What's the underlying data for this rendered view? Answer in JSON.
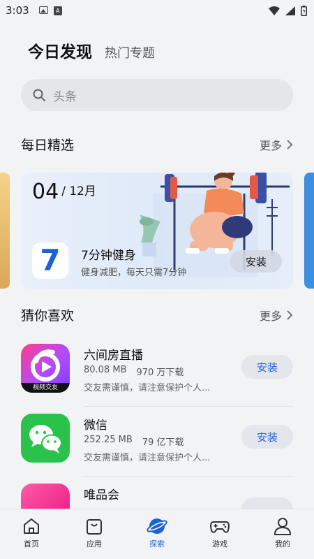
{
  "status_bar": {
    "time": "3:03"
  },
  "top_tabs": {
    "active": "今日发现",
    "other": "热门专题"
  },
  "search": {
    "placeholder": "头条"
  },
  "daily_pick": {
    "title": "每日精选",
    "more": "更多",
    "card": {
      "day": "04",
      "month": "12月",
      "app_name": "7分钟健身",
      "app_desc": "健身减肥，每天只需7分钟",
      "install_label": "安装",
      "icon_text": "7"
    }
  },
  "guess": {
    "title": "猜你喜欢",
    "more": "更多",
    "apps": [
      {
        "name": "六间房直播",
        "size": "80.08 MB",
        "downloads": "970 万下载",
        "warning": "交友需谨慎，请注意保护个人...",
        "install": "安装",
        "icon_caption": "视频交友"
      },
      {
        "name": "微信",
        "size": "252.25 MB",
        "downloads": "79 亿下载",
        "warning": "交友需谨慎，请注意保护个人...",
        "install": "安装"
      },
      {
        "name": "唯品会"
      }
    ]
  },
  "bottom_nav": [
    {
      "label": "首页",
      "icon": "home-icon"
    },
    {
      "label": "应用",
      "icon": "bag-icon"
    },
    {
      "label": "探索",
      "icon": "planet-icon",
      "active": true
    },
    {
      "label": "游戏",
      "icon": "gamepad-icon"
    },
    {
      "label": "我的",
      "icon": "person-icon"
    }
  ],
  "colors": {
    "accent": "#1a63d6",
    "install_text": "#2e66d6",
    "background": "#f1f3f5"
  }
}
